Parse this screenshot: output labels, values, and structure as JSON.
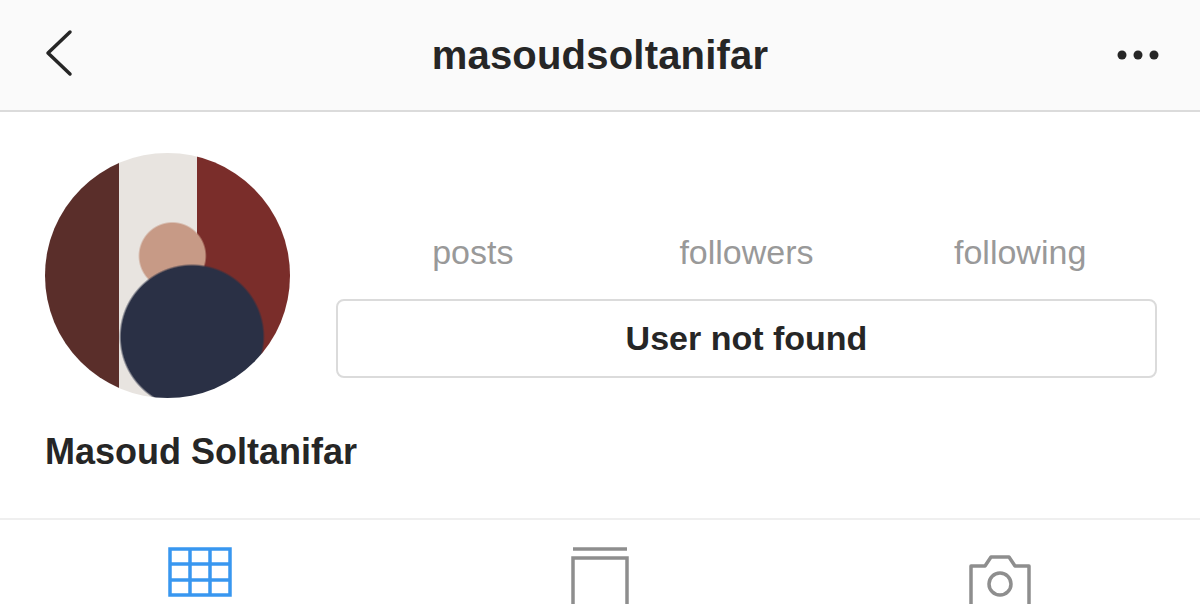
{
  "header": {
    "username": "masoudsoltanifar"
  },
  "stats": [
    {
      "label": "posts"
    },
    {
      "label": "followers"
    },
    {
      "label": "following"
    }
  ],
  "button": {
    "label": "User not found"
  },
  "profile": {
    "name": "Masoud Soltanifar"
  },
  "tabs": [
    {
      "kind": "grid",
      "selected": true
    },
    {
      "kind": "feed",
      "selected": false
    },
    {
      "kind": "tagged",
      "selected": false
    }
  ]
}
